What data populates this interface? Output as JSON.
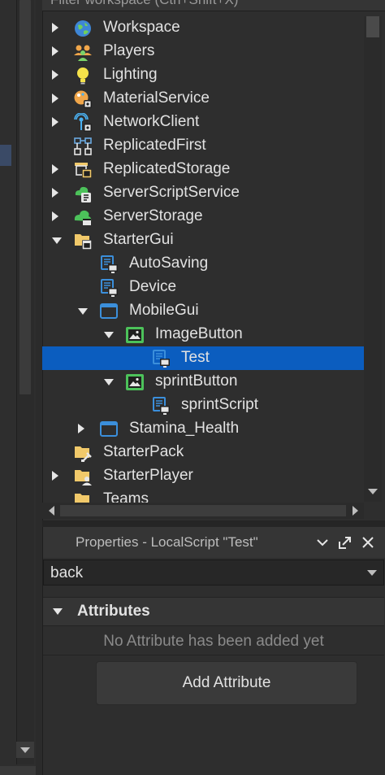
{
  "explorer": {
    "filter_text": "Filter workspace (Ctrl+Shift+X)",
    "items": [
      {
        "label": "Workspace",
        "icon": "workspace-globe-icon",
        "depth": 0,
        "expander": "collapsed"
      },
      {
        "label": "Players",
        "icon": "players-icon",
        "depth": 0,
        "expander": "collapsed"
      },
      {
        "label": "Lighting",
        "icon": "lightbulb-icon",
        "depth": 0,
        "expander": "collapsed"
      },
      {
        "label": "MaterialService",
        "icon": "material-service-icon",
        "depth": 0,
        "expander": "collapsed"
      },
      {
        "label": "NetworkClient",
        "icon": "network-client-icon",
        "depth": 0,
        "expander": "collapsed"
      },
      {
        "label": "ReplicatedFirst",
        "icon": "replicated-first-icon",
        "depth": 0,
        "expander": "none"
      },
      {
        "label": "ReplicatedStorage",
        "icon": "replicated-storage-icon",
        "depth": 0,
        "expander": "collapsed"
      },
      {
        "label": "ServerScriptService",
        "icon": "server-script-service-icon",
        "depth": 0,
        "expander": "collapsed"
      },
      {
        "label": "ServerStorage",
        "icon": "server-storage-icon",
        "depth": 0,
        "expander": "collapsed"
      },
      {
        "label": "StarterGui",
        "icon": "starter-gui-folder-icon",
        "depth": 0,
        "expander": "expanded"
      },
      {
        "label": "AutoSaving",
        "icon": "local-script-icon",
        "depth": 1,
        "expander": "none"
      },
      {
        "label": "Device",
        "icon": "local-script-icon",
        "depth": 1,
        "expander": "none"
      },
      {
        "label": "MobileGui",
        "icon": "screen-gui-icon",
        "depth": 1,
        "expander": "expanded"
      },
      {
        "label": "ImageButton",
        "icon": "image-button-icon",
        "depth": 2,
        "expander": "expanded"
      },
      {
        "label": "Test",
        "icon": "local-script-icon",
        "depth": 3,
        "expander": "none",
        "selected": true
      },
      {
        "label": "sprintButton",
        "icon": "image-button-icon",
        "depth": 2,
        "expander": "expanded"
      },
      {
        "label": "sprintScript",
        "icon": "local-script-icon",
        "depth": 3,
        "expander": "none"
      },
      {
        "label": "Stamina_Health",
        "icon": "screen-gui-icon",
        "depth": 1,
        "expander": "collapsed"
      },
      {
        "label": "StarterPack",
        "icon": "starter-pack-folder-icon",
        "depth": 0,
        "expander": "none"
      },
      {
        "label": "StarterPlayer",
        "icon": "starter-player-folder-icon",
        "depth": 0,
        "expander": "collapsed"
      },
      {
        "label": "Teams",
        "icon": "teams-folder-icon",
        "depth": 0,
        "expander": "none"
      }
    ]
  },
  "properties": {
    "title": "Properties - LocalScript \"Test\"",
    "filter_value": "back",
    "attributes": {
      "header": "Attributes",
      "empty_message": "No Attribute has been added yet",
      "add_label": "Add Attribute"
    }
  },
  "colors": {
    "selection": "#0b5dbf",
    "panel": "#2e2e2e",
    "text": "#e2e2e2",
    "script_blue": "#3b8fdb",
    "gui_green": "#4cc25a",
    "folder_yellow": "#f1c96a"
  }
}
